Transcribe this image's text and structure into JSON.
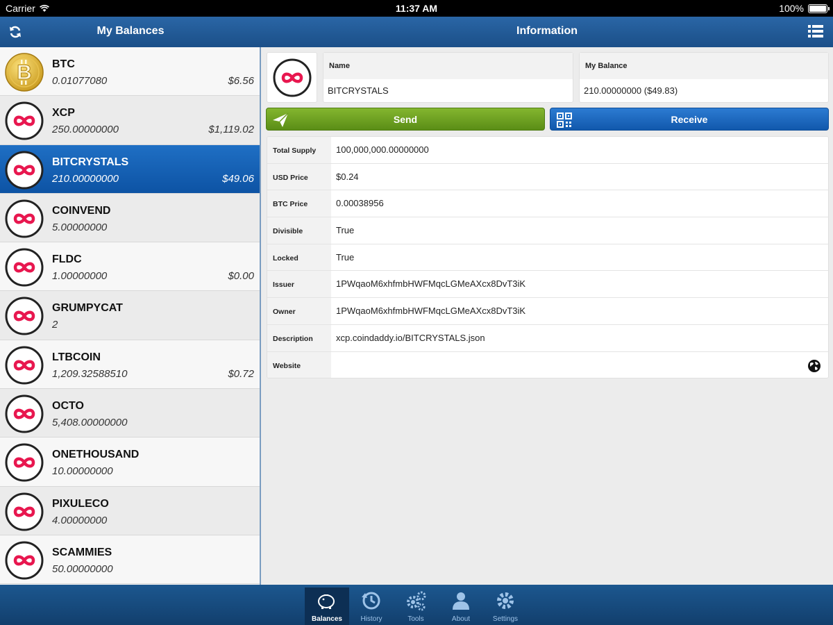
{
  "status_bar": {
    "carrier": "Carrier",
    "time": "11:37 AM",
    "battery": "100%"
  },
  "left_nav": {
    "title": "My Balances"
  },
  "right_nav": {
    "title": "Information"
  },
  "balances": [
    {
      "symbol": "BTC",
      "quantity": "0.01077080",
      "usd": "$6.56",
      "icon": "bitcoin-icon"
    },
    {
      "symbol": "XCP",
      "quantity": "250.00000000",
      "usd": "$1,119.02",
      "icon": "counterparty-icon"
    },
    {
      "symbol": "BITCRYSTALS",
      "quantity": "210.00000000",
      "usd": "$49.06",
      "icon": "counterparty-icon",
      "selected": true
    },
    {
      "symbol": "COINVEND",
      "quantity": "5.00000000",
      "usd": "",
      "icon": "counterparty-icon"
    },
    {
      "symbol": "FLDC",
      "quantity": "1.00000000",
      "usd": "$0.00",
      "icon": "counterparty-icon"
    },
    {
      "symbol": "GRUMPYCAT",
      "quantity": "2",
      "usd": "",
      "icon": "counterparty-icon"
    },
    {
      "symbol": "LTBCOIN",
      "quantity": "1,209.32588510",
      "usd": "$0.72",
      "icon": "counterparty-icon"
    },
    {
      "symbol": "OCTO",
      "quantity": "5,408.00000000",
      "usd": "",
      "icon": "counterparty-icon"
    },
    {
      "symbol": "ONETHOUSAND",
      "quantity": "10.00000000",
      "usd": "",
      "icon": "counterparty-icon"
    },
    {
      "symbol": "PIXULECO",
      "quantity": "4.00000000",
      "usd": "",
      "icon": "counterparty-icon"
    },
    {
      "symbol": "SCAMMIES",
      "quantity": "50.00000000",
      "usd": "",
      "icon": "counterparty-icon"
    }
  ],
  "detail": {
    "name_label": "Name",
    "name_value": "BITCRYSTALS",
    "balance_label": "My Balance",
    "balance_value": "210.00000000 ($49.83)",
    "send_label": "Send",
    "receive_label": "Receive",
    "rows": [
      {
        "key": "Total Supply",
        "value": "100,000,000.00000000"
      },
      {
        "key": "USD Price",
        "value": "$0.24"
      },
      {
        "key": "BTC Price",
        "value": "0.00038956"
      },
      {
        "key": "Divisible",
        "value": "True"
      },
      {
        "key": "Locked",
        "value": "True"
      },
      {
        "key": "Issuer",
        "value": "1PWqaoM6xhfmbHWFMqcLGMeAXcx8DvT3iK"
      },
      {
        "key": "Owner",
        "value": "1PWqaoM6xhfmbHWFMqcLGMeAXcx8DvT3iK"
      },
      {
        "key": "Description",
        "value": "xcp.coindaddy.io/BITCRYSTALS.json"
      },
      {
        "key": "Website",
        "value": ""
      }
    ]
  },
  "tabs": [
    {
      "label": "Balances",
      "icon": "piggy-bank-icon",
      "active": true
    },
    {
      "label": "History",
      "icon": "history-icon"
    },
    {
      "label": "Tools",
      "icon": "gears-icon"
    },
    {
      "label": "About",
      "icon": "person-icon"
    },
    {
      "label": "Settings",
      "icon": "gear-icon"
    }
  ],
  "colors": {
    "nav_blue": "#1f5a96",
    "selected_blue": "#1565b8",
    "send_green": "#6fa322",
    "receive_blue": "#1e6cc3",
    "counterparty_red": "#e8174f"
  }
}
